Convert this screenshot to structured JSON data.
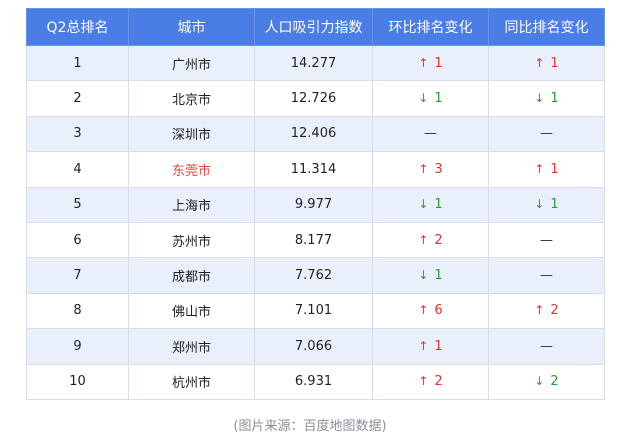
{
  "table": {
    "headers": [
      "Q2总排名",
      "城市",
      "人口吸引力指数",
      "环比排名变化",
      "同比排名变化"
    ],
    "rows": [
      {
        "rank": "1",
        "city": "广州市",
        "index": "14.277",
        "mom": {
          "dir": "up",
          "val": "1"
        },
        "yoy": {
          "dir": "up",
          "val": "1"
        }
      },
      {
        "rank": "2",
        "city": "北京市",
        "index": "12.726",
        "mom": {
          "dir": "down",
          "val": "1"
        },
        "yoy": {
          "dir": "down",
          "val": "1"
        }
      },
      {
        "rank": "3",
        "city": "深圳市",
        "index": "12.406",
        "mom": {
          "dir": "flat",
          "val": "—"
        },
        "yoy": {
          "dir": "flat",
          "val": "—"
        }
      },
      {
        "rank": "4",
        "city": "东莞市",
        "index": "11.314",
        "highlight": true,
        "mom": {
          "dir": "up",
          "val": "3"
        },
        "yoy": {
          "dir": "up",
          "val": "1"
        }
      },
      {
        "rank": "5",
        "city": "上海市",
        "index": "9.977",
        "mom": {
          "dir": "down",
          "val": "1"
        },
        "yoy": {
          "dir": "down",
          "val": "1"
        }
      },
      {
        "rank": "6",
        "city": "苏州市",
        "index": "8.177",
        "mom": {
          "dir": "up",
          "val": "2"
        },
        "yoy": {
          "dir": "flat",
          "val": "—"
        }
      },
      {
        "rank": "7",
        "city": "成都市",
        "index": "7.762",
        "mom": {
          "dir": "down",
          "val": "1"
        },
        "yoy": {
          "dir": "flat",
          "val": "—"
        }
      },
      {
        "rank": "8",
        "city": "佛山市",
        "index": "7.101",
        "mom": {
          "dir": "up",
          "val": "6"
        },
        "yoy": {
          "dir": "up",
          "val": "2"
        }
      },
      {
        "rank": "9",
        "city": "郑州市",
        "index": "7.066",
        "mom": {
          "dir": "up",
          "val": "1"
        },
        "yoy": {
          "dir": "flat",
          "val": "—"
        }
      },
      {
        "rank": "10",
        "city": "杭州市",
        "index": "6.931",
        "mom": {
          "dir": "up",
          "val": "2"
        },
        "yoy": {
          "dir": "down",
          "val": "2"
        }
      }
    ]
  },
  "caption": "(图片来源：百度地图数据)",
  "colors": {
    "header_bg": "#4a7de6",
    "row_alt_bg": "#eaf0fb",
    "up": "#e5322d",
    "down": "#2c9a3a",
    "highlight_city": "#e34a3c"
  },
  "icons": {
    "up": "arrow-up-icon",
    "down": "arrow-down-icon"
  }
}
